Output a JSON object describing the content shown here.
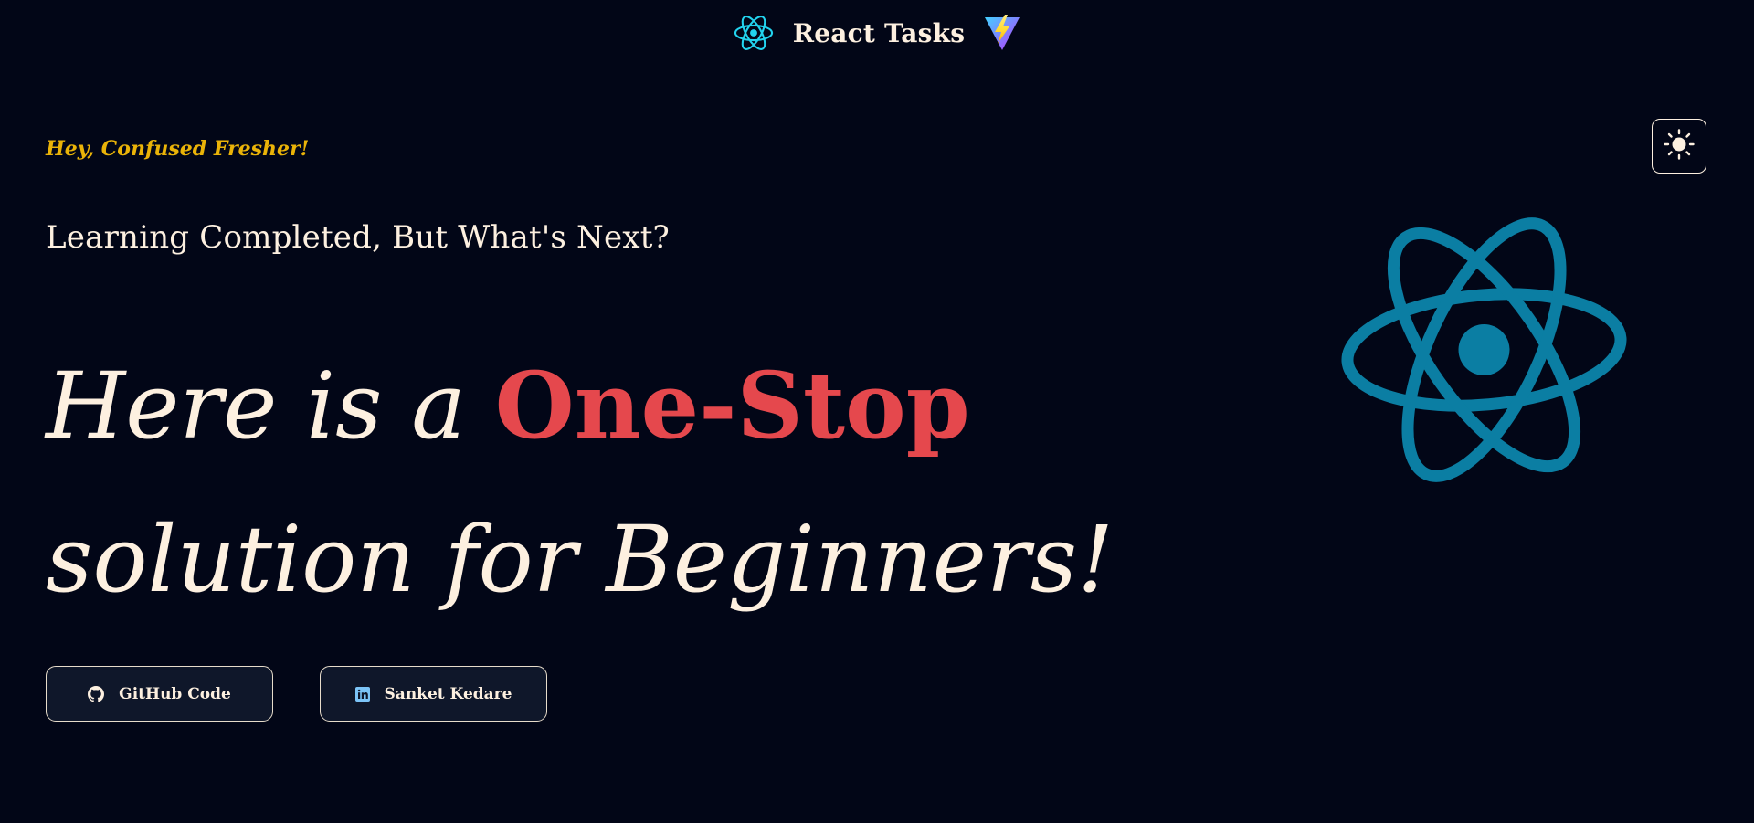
{
  "header": {
    "title": "React Tasks",
    "left_icon": "react-logo-icon",
    "right_icon": "vite-logo-icon"
  },
  "theme_toggle": {
    "icon": "sun-icon"
  },
  "hero": {
    "eyebrow": "Hey, Confused Fresher!",
    "subheading": "Learning Completed, But What's Next?",
    "headline_part1": "Here is a ",
    "headline_accent": "One-Stop",
    "headline_part2": "solution for Beginners!",
    "logo_icon": "react-logo-icon"
  },
  "buttons": [
    {
      "label": "GitHub Code",
      "icon": "github-icon"
    },
    {
      "label": "Sanket Kedare",
      "icon": "linkedin-icon"
    }
  ],
  "colors": {
    "background": "#020617",
    "text": "#fdf0e0",
    "eyebrow": "#eab308",
    "accent": "#e5484d",
    "react_cyan": "#22d3ee",
    "react_teal": "#0b7ea3",
    "button_bg": "#0f172a",
    "linkedin_blue": "#7cc4f7"
  }
}
